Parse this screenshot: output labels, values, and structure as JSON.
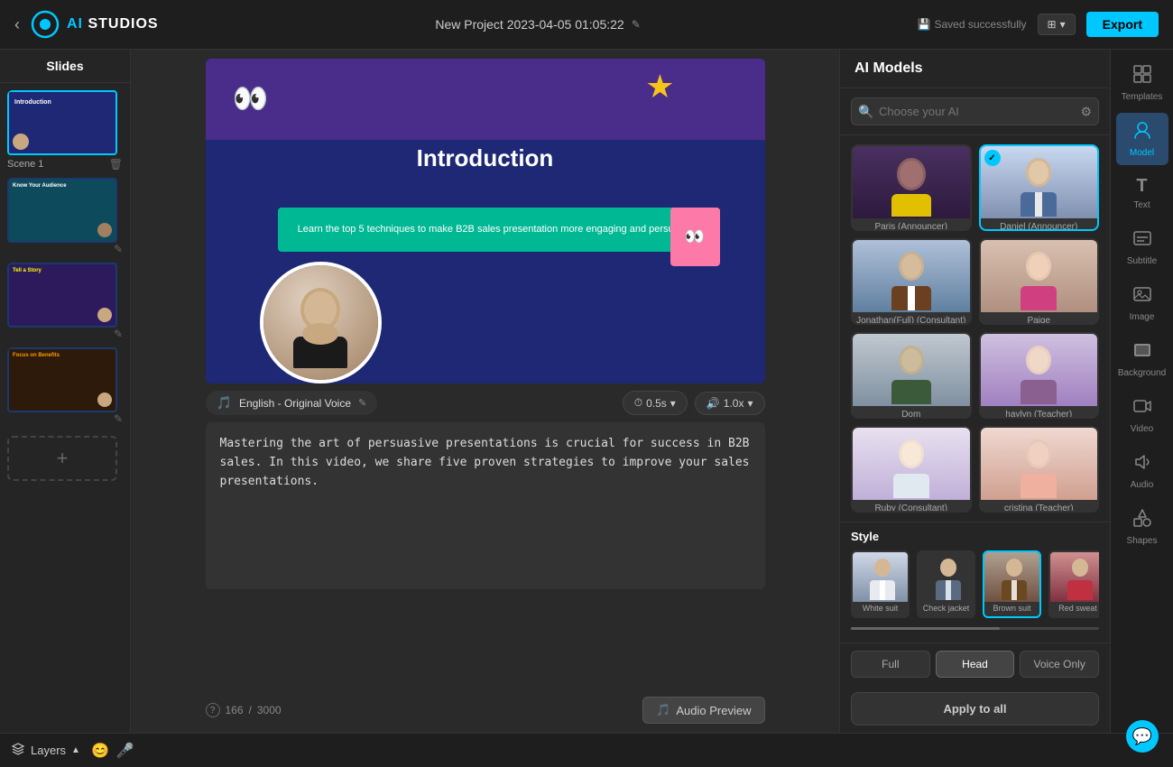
{
  "topbar": {
    "back_label": "‹",
    "logo": "AI STUDIOS",
    "logo_accent": "AI",
    "project_title": "New Project 2023-04-05 01:05:22",
    "edit_icon": "✎",
    "saved_icon": "💾",
    "saved_label": "Saved successfully",
    "view_label": "⊞",
    "export_label": "Export"
  },
  "slides_panel": {
    "header": "Slides",
    "items": [
      {
        "label": "Scene 1",
        "type": "intro",
        "active": true
      },
      {
        "label": "",
        "type": "teal",
        "active": false
      },
      {
        "label": "",
        "type": "purple",
        "active": false
      },
      {
        "label": "",
        "type": "orange",
        "active": false
      }
    ],
    "add_label": "+"
  },
  "canvas": {
    "slide_title": "Introduction",
    "slide_body": "Learn the top 5 techniques to make B2B sales presentation more engaging and persuasive.",
    "voice_label": "English - Original Voice",
    "timing_label": "0.5s",
    "speed_label": "1.0x",
    "text_content": "Mastering the art of persuasive presentations is crucial for success in B2B sales. In this video, we share five proven strategies to improve your sales presentations.",
    "char_current": "166",
    "char_max": "3000",
    "audio_preview_label": "Audio Preview"
  },
  "ai_panel": {
    "header": "AI Models",
    "search_placeholder": "Choose your AI",
    "models": [
      {
        "name": "Paris (Announcer)",
        "type": "paris",
        "selected": false
      },
      {
        "name": "Daniel (Announcer)",
        "type": "daniel",
        "selected": true
      },
      {
        "name": "Jonathan(Full) (Consultant)",
        "type": "jonathan",
        "selected": false
      },
      {
        "name": "Paige",
        "type": "paige",
        "selected": false
      },
      {
        "name": "Dom",
        "type": "dom",
        "selected": false
      },
      {
        "name": "haylyn (Teacher)",
        "type": "haylyn",
        "selected": false
      },
      {
        "name": "Ruby (Consultant)",
        "type": "ruby",
        "selected": false
      },
      {
        "name": "cristina (Teacher)",
        "type": "cristina",
        "selected": false
      }
    ],
    "style_label": "Style",
    "styles": [
      {
        "name": "White suit",
        "selected": false
      },
      {
        "name": "Check jacket",
        "selected": false
      },
      {
        "name": "Brown suit",
        "selected": true
      },
      {
        "name": "Red sweat",
        "selected": false
      }
    ],
    "position_tabs": [
      {
        "label": "Full",
        "active": false
      },
      {
        "label": "Head",
        "active": true
      },
      {
        "label": "Voice Only",
        "active": false
      }
    ],
    "apply_label": "Apply to all"
  },
  "toolbar": {
    "items": [
      {
        "label": "Templates",
        "icon": "⊞",
        "active": false
      },
      {
        "label": "Model",
        "icon": "👤",
        "active": true
      },
      {
        "label": "Text",
        "icon": "T",
        "active": false
      },
      {
        "label": "Subtitle",
        "icon": "▤",
        "active": false
      },
      {
        "label": "Image",
        "icon": "🖼",
        "active": false
      },
      {
        "label": "Background",
        "icon": "⬛",
        "active": false
      },
      {
        "label": "Video",
        "icon": "🎬",
        "active": false
      },
      {
        "label": "Audio",
        "icon": "♫",
        "active": false
      },
      {
        "label": "Shapes",
        "icon": "◇",
        "active": false
      }
    ]
  },
  "bottom": {
    "layers_label": "Layers",
    "chevron": "▲"
  }
}
